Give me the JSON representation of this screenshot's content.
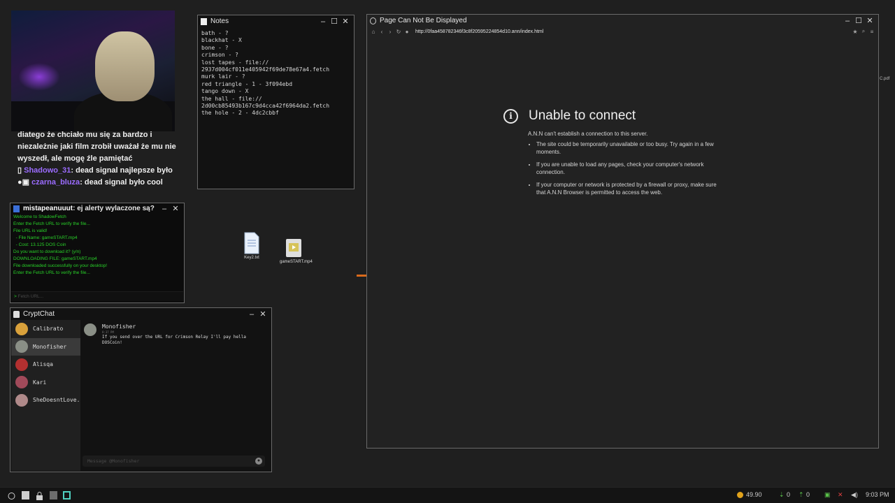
{
  "stream_chat": {
    "lines": [
      "diatego że chciało mu się za bardzo i niezależnie jaki film zrobił uważał że mu nie wyszedł, ale mogę źle pamiętać"
    ],
    "messages": [
      {
        "user": "Shadowo_31",
        "text": "dead signal najlepsze było",
        "color": "#9b6cff"
      },
      {
        "user": "czarna_bluza",
        "text": "dead signal było cool",
        "color": "#9b6cff"
      },
      {
        "user": "mistapeanuuut",
        "text": "ej alerty wylaczone są?",
        "color": "#ffffff"
      }
    ]
  },
  "notes": {
    "title": "Notes",
    "lines": [
      "bath - ?",
      "blackhat - X",
      "bone - ?",
      "crimson - ?",
      "lost tapes - file://",
      "2937d004cf011e405942f69de78e67a4.fetch",
      "murk lair - ?",
      "red triangle - 1 - 3f094ebd",
      "tango down - X",
      "the hall - file://",
      "2d00cb85493b167c9d4cca42f6964da2.fetch",
      "the hole - 2 - 4dc2cbbf"
    ]
  },
  "shadowfetch": {
    "lines": [
      "Welcome to ShadowFetch",
      "Enter the Fetch URL to verify the file...",
      "File URL is valid!",
      "  - File Name: gameSTART.mp4",
      "  - Cost: 13.125 DOS Coin",
      "Do you want to download it? (y/n)",
      "DOWNLOADING FILE: gameSTART.mp4",
      "File downloaded successfully on your desktop!",
      "Enter the Fetch URL to verify the file..."
    ],
    "input_placeholder": "Fetch URL..."
  },
  "cryptchat": {
    "title": "CryptChat",
    "contacts": [
      {
        "name": "Calibrato",
        "color": "#d9a13b"
      },
      {
        "name": "Monofisher",
        "color": "#8a8f86"
      },
      {
        "name": "Alisqa",
        "color": "#b33030"
      },
      {
        "name": "Kari",
        "color": "#a14a5a"
      },
      {
        "name": "SheDoesntLove...",
        "color": "#b08a8a"
      }
    ],
    "message": {
      "sender": "Monofisher",
      "time": "8:37 PM",
      "text": "If you send over the URL for Crimson Relay  I'll pay hella DOSCoin!"
    },
    "input_placeholder": "Message @Monofisher"
  },
  "browser": {
    "title": "Page Can Not Be Displayed",
    "url": "http://0faa458782346f3c8f20595224854d10.ann/index.html",
    "error_title": "Unable to connect",
    "error_sub": "A.N.N can't establish a connection  to this server.",
    "bullets": [
      "The site could be temporarily unavailable or too busy. Try again in a few moments.",
      "If you are unable to load any pages, check your computer's network connection.",
      "If your computer or network is protected by a firewall or proxy, make sure that A.N.N Browser is permitted to access the web."
    ]
  },
  "desktop": {
    "icons": [
      {
        "label": "Key2.txt"
      },
      {
        "label": "gameSTART.mp4"
      }
    ],
    "partial_label": "C.pdf"
  },
  "taskbar": {
    "coin_balance": "49.90",
    "net_down": "0",
    "net_up": "0",
    "clock": "9:03 PM"
  }
}
